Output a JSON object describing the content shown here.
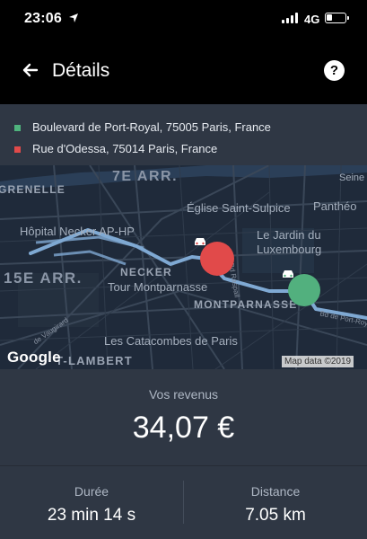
{
  "status_bar": {
    "time": "23:06",
    "network": "4G",
    "battery_level": 0.3,
    "icons": [
      "location-arrow-icon",
      "signal-icon",
      "battery-icon"
    ]
  },
  "nav": {
    "title": "Détails",
    "back_icon": "arrow-left-icon",
    "help_label": "?"
  },
  "addresses": {
    "pickup": {
      "text": "Boulevard de Port-Royal, 75005 Paris, France",
      "color": "#4fb37d"
    },
    "dropoff": {
      "text": "Rue d'Odessa, 75014 Paris, France",
      "color": "#e14a4a"
    }
  },
  "map": {
    "labels": {
      "arr7": "7E ARR.",
      "grenelle": "GRENELLE",
      "saint_sulpice": "Église Saint-Sulpice",
      "pantheon": "Panthéo",
      "seine": "Seine",
      "hopital": "Hôpital Necker AP-HP",
      "jardin1": "Le Jardin du",
      "jardin2": "Luxembourg",
      "arr15": "15E ARR.",
      "necker": "NECKER",
      "tour": "Tour Montparnasse",
      "bd_raspail": "Bd Raspail",
      "montparnasse": "MONTPARNASSE",
      "bd_port_royal": "Bd de Port-Roy",
      "vaugirard": "de Vaugirard",
      "catacombes": "Les Catacombes de Paris",
      "lambert": "T-LAMBERT"
    },
    "google": "Google",
    "credit": "Map data ©2019",
    "route_color": "#7fa9d3",
    "pins": {
      "start_color": "#52b07e",
      "end_color": "#e14a4a"
    }
  },
  "earnings": {
    "label": "Vos revenus",
    "value": "34,07 €"
  },
  "stats": {
    "duration_label": "Durée",
    "duration_value": "23 min 14 s",
    "distance_label": "Distance",
    "distance_value": "7.05 km"
  }
}
